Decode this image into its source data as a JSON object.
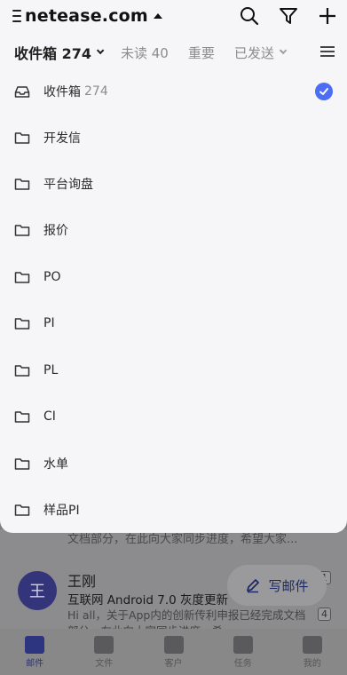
{
  "header": {
    "account": "netease.com",
    "icons": [
      "search-icon",
      "filter-icon",
      "plus-icon"
    ]
  },
  "tabs": [
    {
      "label": "收件箱 274",
      "active": true,
      "chevron": true
    },
    {
      "label": "未读 40",
      "active": false,
      "chevron": false
    },
    {
      "label": "重要",
      "active": false,
      "chevron": false
    },
    {
      "label": "已发送",
      "active": false,
      "chevron": true
    }
  ],
  "folders": [
    {
      "label": "收件箱",
      "count": "274",
      "icon": "inbox-icon",
      "selected": true
    },
    {
      "label": "开发信",
      "count": "",
      "icon": "folder-icon",
      "selected": false
    },
    {
      "label": "平台询盘",
      "count": "",
      "icon": "folder-icon",
      "selected": false
    },
    {
      "label": "报价",
      "count": "",
      "icon": "folder-icon",
      "selected": false
    },
    {
      "label": "PO",
      "count": "",
      "icon": "folder-icon",
      "selected": false
    },
    {
      "label": "PI",
      "count": "",
      "icon": "folder-icon",
      "selected": false
    },
    {
      "label": "PL",
      "count": "",
      "icon": "folder-icon",
      "selected": false
    },
    {
      "label": "CI",
      "count": "",
      "icon": "folder-icon",
      "selected": false
    },
    {
      "label": "水单",
      "count": "",
      "icon": "folder-icon",
      "selected": false
    },
    {
      "label": "样品PI",
      "count": "",
      "icon": "folder-icon",
      "selected": false
    }
  ],
  "background_list": {
    "snippet_top": "文档部分，在此向大家同步进度，希望大家...",
    "mail": {
      "avatar": "王",
      "sender": "王刚",
      "subject": "互联网 Android 7.0 灰度更新",
      "preview": "Hi all，关于App内的创新传利申报已经完成文档部分，在此向大家同步进度，希",
      "badge_top": "1",
      "badge": "4"
    }
  },
  "compose": {
    "label": "写邮件"
  },
  "bottom_nav": [
    {
      "label": "邮件",
      "icon": "mail-icon",
      "active": true
    },
    {
      "label": "文件",
      "icon": "file-icon",
      "active": false
    },
    {
      "label": "客户",
      "icon": "customer-icon",
      "active": false
    },
    {
      "label": "任务",
      "icon": "task-icon",
      "active": false
    },
    {
      "label": "我的",
      "icon": "profile-icon",
      "active": false
    }
  ],
  "colors": {
    "accent": "#4c6ef5",
    "nav_active": "#2d3480",
    "panel_bg": "#f6f6f8",
    "overlay_bg": "#7d7d7f"
  }
}
